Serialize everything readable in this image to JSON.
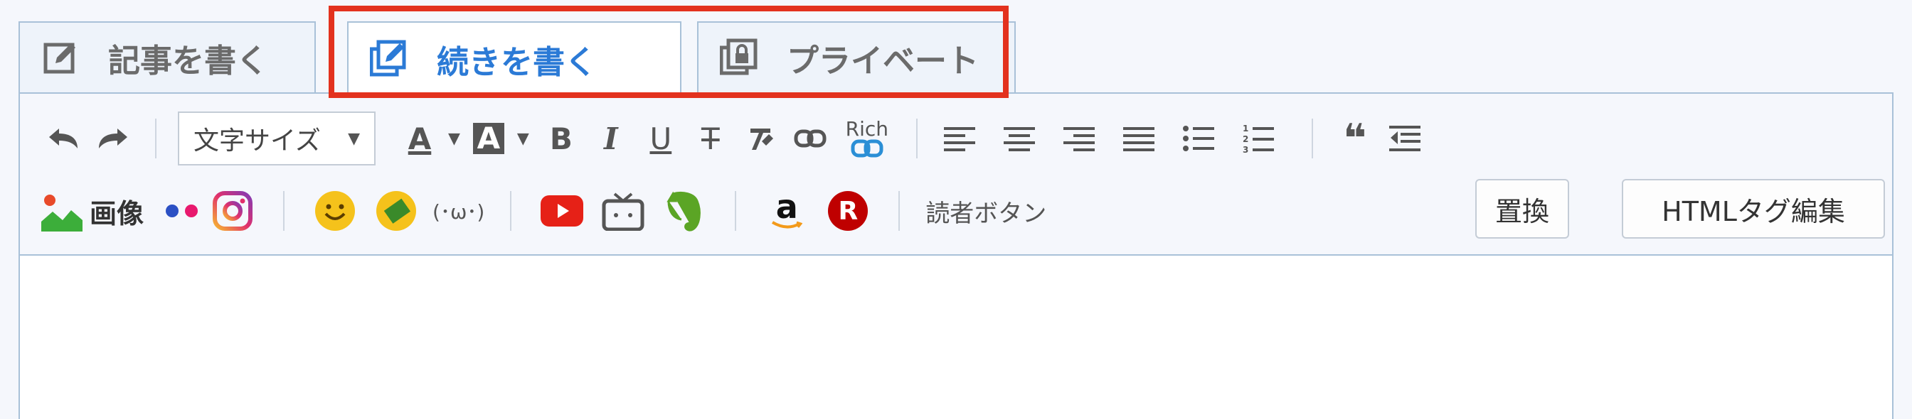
{
  "tabs": [
    {
      "label": "記事を書く",
      "icon": "edit-icon",
      "active": false
    },
    {
      "label": "続きを書く",
      "icon": "edit-continue-icon",
      "active": true
    },
    {
      "label": "プライベート",
      "icon": "private-lock-icon",
      "active": false
    }
  ],
  "toolbar": {
    "font_size_select": "文字サイズ",
    "rich_label": "Rich",
    "image_label": "画像",
    "reader_button": "読者ボタン",
    "replace_button": "置換",
    "html_edit_button": "HTMLタグ編集",
    "kaomoji_label": "(･ω･)",
    "bold_label": "B",
    "italic_label": "I",
    "underline_label": "U",
    "strike_label": "T",
    "font_color_label": "A",
    "bg_color_label": "A",
    "quote_label": "❝",
    "amazon_label": "a",
    "rakuten_label": "R"
  },
  "colors": {
    "accent": "#2b7ad6",
    "highlight": "#e3321e",
    "border": "#a9c1d8",
    "youtube": "#e62117",
    "rakuten": "#bf0000",
    "evernote": "#5ba525",
    "instagram": "#c13584"
  }
}
